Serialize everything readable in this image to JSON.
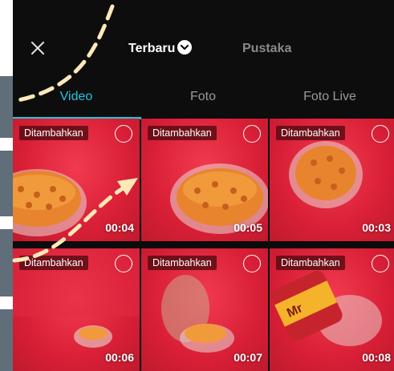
{
  "header": {
    "close_icon": "close-icon",
    "tabs": [
      {
        "label": "Terbaru",
        "active": true
      },
      {
        "label": "Pustaka",
        "active": false
      }
    ]
  },
  "media_tabs": [
    {
      "label": "Video",
      "active": true
    },
    {
      "label": "Foto",
      "active": false
    },
    {
      "label": "Foto Live",
      "active": false
    }
  ],
  "grid": [
    {
      "tag": "Ditambahkan",
      "duration": "00:04"
    },
    {
      "tag": "Ditambahkan",
      "duration": "00:05"
    },
    {
      "tag": "Ditambahkan",
      "duration": "00:03"
    },
    {
      "tag": "Ditambahkan",
      "duration": "00:06"
    },
    {
      "tag": "Ditambahkan",
      "duration": "00:07"
    },
    {
      "tag": "Ditambahkan",
      "duration": "00:08"
    }
  ],
  "colors": {
    "accent": "#1fc7e0",
    "background": "#0b0b0c",
    "thumb_red": "#d81f36",
    "annotation_arrow": "#fde9b8"
  }
}
